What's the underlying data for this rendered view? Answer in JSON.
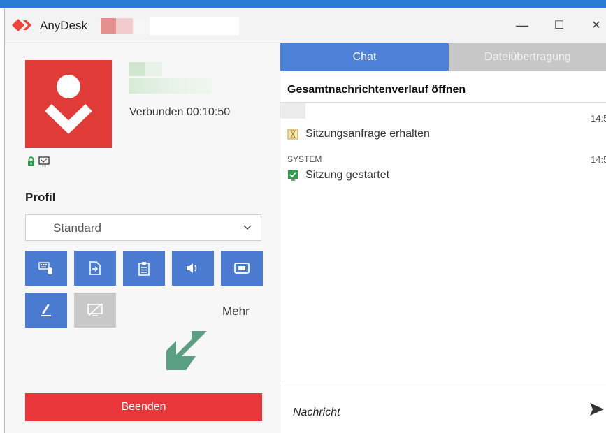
{
  "window": {
    "app_name": "AnyDesk",
    "buttons": {
      "minimize": "—",
      "maximize": "☐",
      "close": "✕"
    }
  },
  "session": {
    "status": "Verbunden 00:10:50"
  },
  "profile": {
    "label": "Profil",
    "selected": "Standard"
  },
  "toolbar": {
    "items": [
      {
        "icon": "keyboard-mouse-icon",
        "enabled": true
      },
      {
        "icon": "file-transfer-icon",
        "enabled": true
      },
      {
        "icon": "clipboard-icon",
        "enabled": true
      },
      {
        "icon": "audio-icon",
        "enabled": true
      },
      {
        "icon": "screen-record-icon",
        "enabled": true
      },
      {
        "icon": "pen-icon",
        "enabled": true
      },
      {
        "icon": "block-input-icon",
        "enabled": false
      }
    ],
    "more_label": "Mehr"
  },
  "end_button": "Beenden",
  "tabs": [
    {
      "label": "Chat",
      "active": true
    },
    {
      "label": "Dateiübertragung",
      "active": false
    }
  ],
  "chat": {
    "history_link": "Gesamtnachrichtenverlauf öffnen",
    "messages": [
      {
        "sender": "",
        "time": "14:5",
        "text": "Sitzungsanfrage erhalten",
        "icon": "hourglass-icon"
      },
      {
        "sender": "SYSTEM",
        "time": "14:5",
        "text": "Sitzung gestartet",
        "icon": "session-started-icon"
      }
    ],
    "input_placeholder": "Nachricht"
  },
  "colors": {
    "accent_blue": "#4b7bd1",
    "anydesk_red": "#e13b37",
    "end_button_red": "#e8363a",
    "arrow_green": "#5a9e85"
  }
}
